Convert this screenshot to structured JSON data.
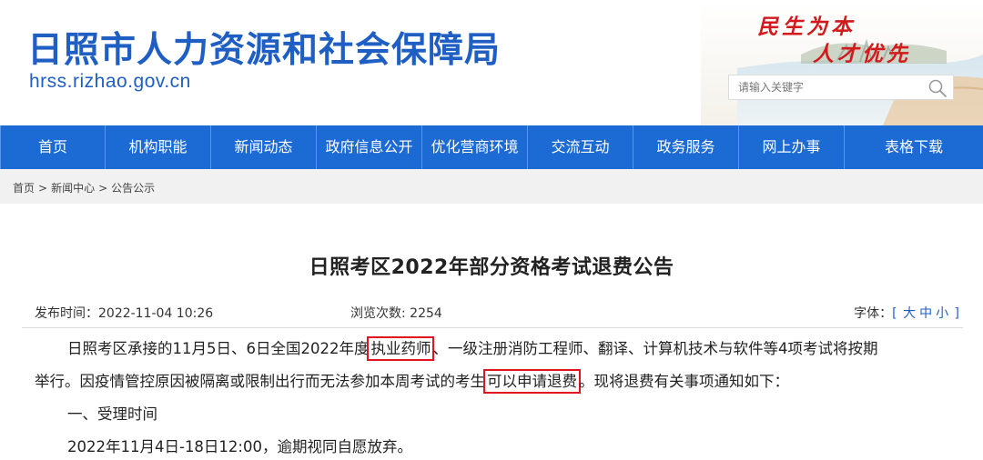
{
  "header": {
    "title": "日照市人力资源和社会保障局",
    "domain": "hrss.rizhao.gov.cn",
    "slogan_line1": "民生为本",
    "slogan_line2": "人才优先"
  },
  "search": {
    "placeholder": "请输入关键字"
  },
  "nav": {
    "items": [
      "首页",
      "机构职能",
      "新闻动态",
      "政府信息公开",
      "优化营商环境",
      "交流互动",
      "政务服务",
      "网上办事",
      "表格下载"
    ]
  },
  "breadcrumb": {
    "home": "首页",
    "news": "新闻中心",
    "notice": "公告公示",
    "sep": ">"
  },
  "article": {
    "title": "日照考区2022年部分资格考试退费公告",
    "date_label": "发布时间：2022-11-04 10:26",
    "views_label": "浏览次数: 2254",
    "font_label": "字体：",
    "font_large": "大",
    "font_medium": "中",
    "font_small": "小",
    "p1_a": "日照考区承接的11月5日、6日全国2022年度",
    "p1_hl": "执业药师",
    "p1_b": "、一级注册消防工程师、翻译、计算机技术与软件等4项考试将按期",
    "p2_a": "举行。因疫情管控原因被隔离或限制出行而无法参加本周考试的考生",
    "p2_hl": "可以申请退费",
    "p2_b": "。现将退费有关事项通知如下：",
    "p3": "一、受理时间",
    "p4": "2022年11月4日-18日12:00，逾期视同自愿放弃。"
  },
  "colors": {
    "brand_blue": "#1c6ad4",
    "highlight_red": "#e0141c",
    "slogan_red": "#d2191c"
  },
  "icons": {
    "search": "search-icon"
  }
}
